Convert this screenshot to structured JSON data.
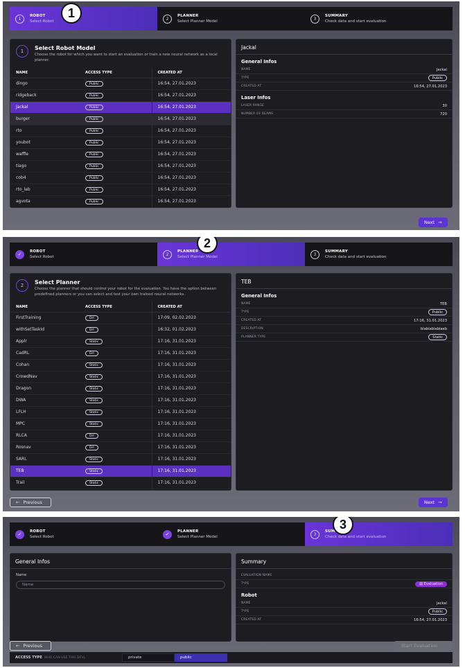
{
  "callouts": [
    "1",
    "2",
    "3"
  ],
  "stepper": {
    "steps": [
      {
        "num": "1",
        "title": "ROBOT",
        "sub": "Select Robot"
      },
      {
        "num": "2",
        "title": "PLANNER",
        "sub": "Select Planner Model"
      },
      {
        "num": "3",
        "title": "SUMMARY",
        "sub": "Check data and start evaluation"
      }
    ],
    "done_mark": "✓"
  },
  "robot_step": {
    "num": "1",
    "title": "Select Robot Model",
    "description": "Choose the robot for which you want to start an evaluation or train a new neural network as a local planner.",
    "columns": [
      "NAME",
      "ACCESS TYPE",
      "CREATED AT"
    ],
    "rows": [
      {
        "name": "dingo",
        "access": "Public",
        "created": "16:54, 27.01.2023"
      },
      {
        "name": "ridgeback",
        "access": "Public",
        "created": "16:54, 27.01.2023"
      },
      {
        "name": "jackal",
        "access": "Public",
        "created": "16:54, 27.01.2023"
      },
      {
        "name": "burger",
        "access": "Public",
        "created": "16:54, 27.01.2023"
      },
      {
        "name": "rto",
        "access": "Public",
        "created": "16:54, 27.01.2023"
      },
      {
        "name": "youbot",
        "access": "Public",
        "created": "16:54, 27.01.2023"
      },
      {
        "name": "waffle",
        "access": "Public",
        "created": "16:54, 27.01.2023"
      },
      {
        "name": "tiago",
        "access": "Public",
        "created": "16:54, 27.01.2023"
      },
      {
        "name": "cob4",
        "access": "Public",
        "created": "16:54, 27.01.2023"
      },
      {
        "name": "rto_lab",
        "access": "Public",
        "created": "16:54, 27.01.2023"
      },
      {
        "name": "agvota",
        "access": "Public",
        "created": "16:54, 27.01.2023"
      }
    ],
    "selected_index": 2,
    "hover_index": 3,
    "detail": {
      "title": "Jackal",
      "general_title": "General Infos",
      "general": [
        {
          "k": "NAME",
          "v": "Jackal"
        },
        {
          "k": "TYPE",
          "v": "Public",
          "pill": true
        },
        {
          "k": "CREATED AT",
          "v": "16:54, 27.01.2023"
        }
      ],
      "laser_title": "Laser Infos",
      "laser": [
        {
          "k": "LASER RANGE",
          "v": "30"
        },
        {
          "k": "NUMBER OF BEAMS",
          "v": "720"
        }
      ]
    },
    "next_label": "Next"
  },
  "planner_step": {
    "num": "2",
    "title": "Select Planner",
    "description": "Choose the planner that should control your robot for the evaluation. You have the option between predefined planners or you can select and test your own trained neural networks.",
    "columns": [
      "NAME",
      "ACCESS TYPE",
      "CREATED AT"
    ],
    "rows": [
      {
        "name": "FirstTraining",
        "access": "Drl",
        "created": "17:09, 02.02.2023"
      },
      {
        "name": "withSetTaskId",
        "access": "Drl",
        "created": "16:32, 01.02.2023"
      },
      {
        "name": "Applr",
        "access": "Static",
        "created": "17:16, 31.01.2023"
      },
      {
        "name": "CadRL",
        "access": "Drl",
        "created": "17:16, 31.01.2023"
      },
      {
        "name": "Cohan",
        "access": "Static",
        "created": "17:16, 31.01.2023"
      },
      {
        "name": "CrowdNav",
        "access": "Static",
        "created": "17:16, 31.01.2023"
      },
      {
        "name": "Dragon",
        "access": "Static",
        "created": "17:16, 31.01.2023"
      },
      {
        "name": "DWA",
        "access": "Static",
        "created": "17:16, 31.01.2023"
      },
      {
        "name": "LFLH",
        "access": "Static",
        "created": "17:16, 31.01.2023"
      },
      {
        "name": "MPC",
        "access": "Static",
        "created": "17:16, 31.01.2023"
      },
      {
        "name": "RLCA",
        "access": "Drl",
        "created": "17:16, 31.01.2023"
      },
      {
        "name": "Rosnav",
        "access": "Drl",
        "created": "17:16, 31.01.2023"
      },
      {
        "name": "SARL",
        "access": "Static",
        "created": "17:16, 31.01.2023"
      },
      {
        "name": "TEB",
        "access": "Static",
        "created": "17:16, 31.01.2023"
      },
      {
        "name": "Trail",
        "access": "Static",
        "created": "17:16, 31.01.2023"
      }
    ],
    "selected_index": 13,
    "detail": {
      "title": "TEB",
      "general_title": "General Infos",
      "general": [
        {
          "k": "NAME",
          "v": "TEB"
        },
        {
          "k": "TYPE",
          "v": "Public",
          "pill": true
        },
        {
          "k": "CREATED AT",
          "v": "17:16, 31.01.2023"
        },
        {
          "k": "DESCRIPTION",
          "v": "blablablablaeb"
        },
        {
          "k": "PLANNER TYPE",
          "v": "Static",
          "pill": true
        }
      ]
    },
    "previous_label": "Previous",
    "next_label": "Next"
  },
  "summary_step": {
    "general_title": "General Infos",
    "name_label": "Name",
    "name_placeholder": "Name",
    "summary_title": "Summary",
    "summary_rows": [
      {
        "k": "EVALUATION NAME",
        "v": ""
      },
      {
        "k": "TYPE",
        "v": "Evaluation",
        "badge": true
      }
    ],
    "robot_title": "Robot",
    "robot_rows": [
      {
        "k": "NAME",
        "v": "jackal"
      },
      {
        "k": "TYPE",
        "v": "Public",
        "pill": true
      },
      {
        "k": "CREATED AT",
        "v": "16:54, 27.01.2023"
      }
    ],
    "previous_label": "Previous",
    "start_label": "Start Evaluation",
    "access": {
      "label": "ACCESS TYPE",
      "hint": "WHO CAN USE THIS DEVL",
      "options": [
        "private",
        "public"
      ],
      "selected": "public"
    }
  },
  "colors": {
    "accent": "#5b33d6",
    "selected_row": "#5b2fc0",
    "eval_badge": "#8b2fd6"
  }
}
